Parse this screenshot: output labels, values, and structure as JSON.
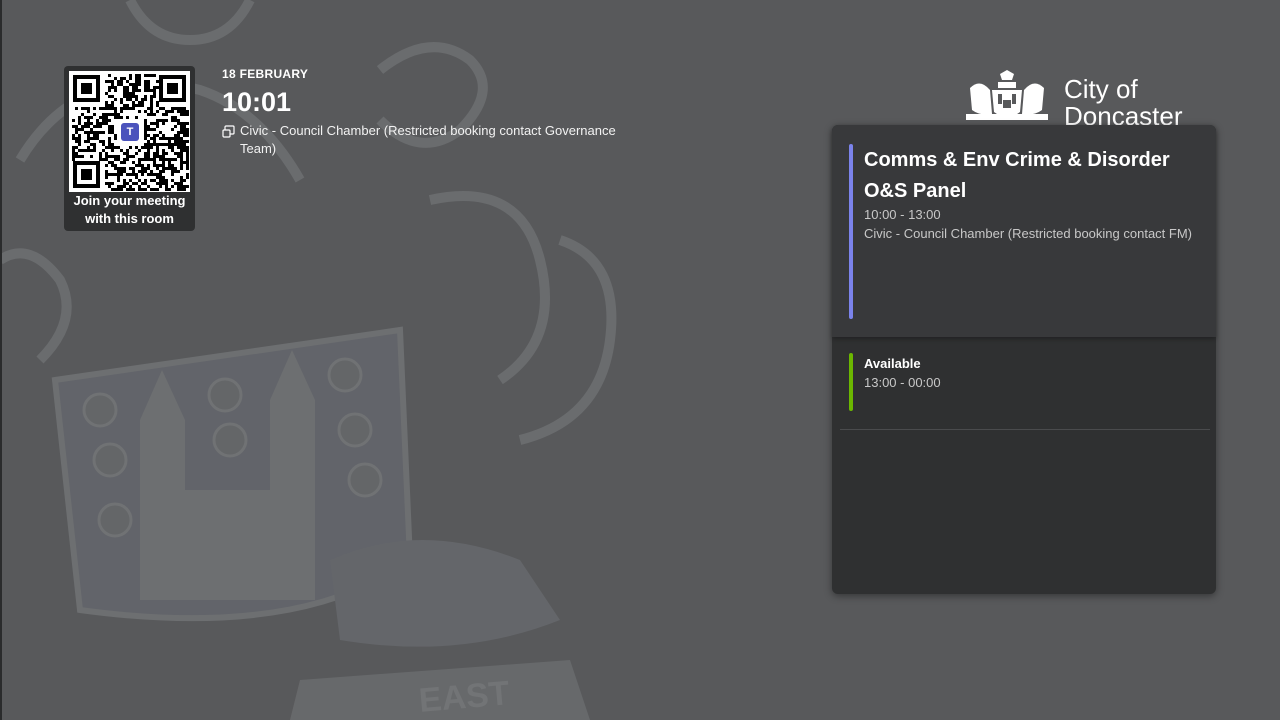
{
  "qr": {
    "caption": "Join your meeting with this room"
  },
  "header": {
    "date": "18 FEBRUARY",
    "time": "10:01",
    "room": "Civic - Council Chamber (Restricted booking contact Governance Team)"
  },
  "logo": {
    "line1": "City of",
    "line2": "Doncaster"
  },
  "current_meeting": {
    "title": "Comms & Env Crime & Disorder O&S Panel",
    "time": "10:00 - 13:00",
    "location": "Civic - Council Chamber (Restricted booking contact FM)"
  },
  "next_slot": {
    "status": "Available",
    "time": "13:00 - 00:00"
  },
  "colors": {
    "background": "#58595b",
    "panel": "#2f3031",
    "meeting_accent": "#7b83eb",
    "available_accent": "#6bb700"
  },
  "icons": [
    "room-icon",
    "teams-icon"
  ]
}
